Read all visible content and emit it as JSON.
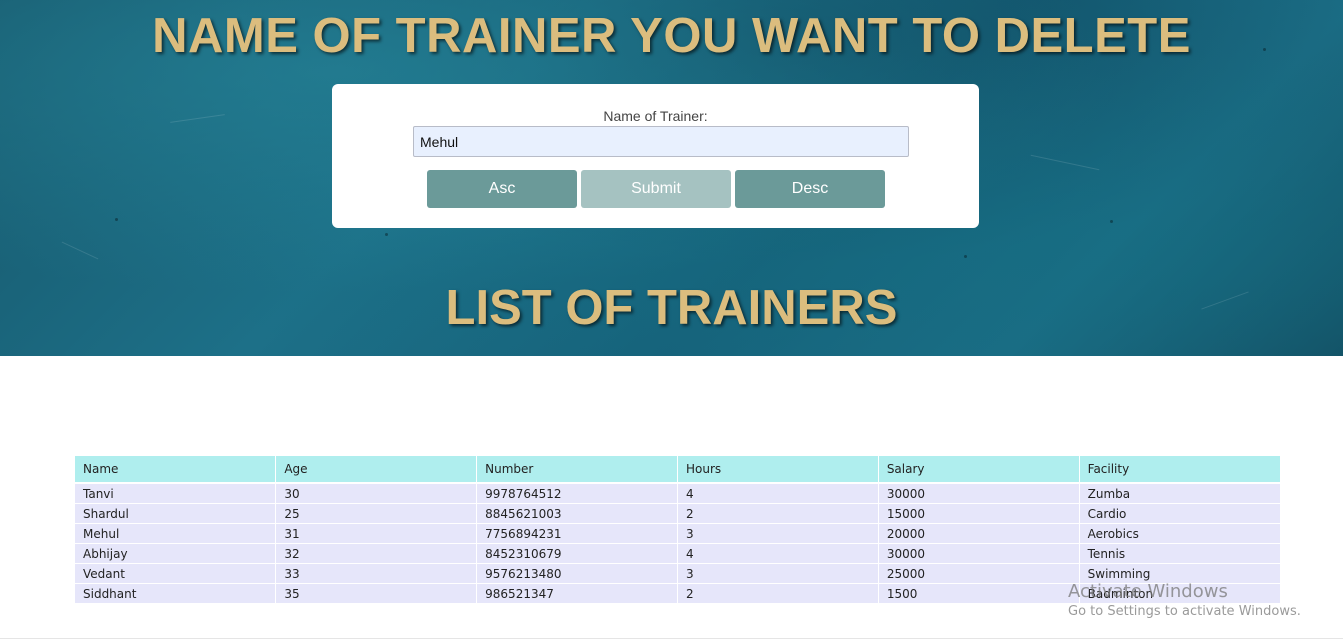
{
  "header": {
    "title": "NAME OF TRAINER YOU WANT TO DELETE",
    "list_title": "LIST OF TRAINERS"
  },
  "form": {
    "label": "Name of Trainer:",
    "input_value": "Mehul",
    "buttons": {
      "asc": "Asc",
      "submit": "Submit",
      "desc": "Desc"
    }
  },
  "table": {
    "columns": [
      "Name",
      "Age",
      "Number",
      "Hours",
      "Salary",
      "Facility"
    ],
    "rows": [
      [
        "Tanvi",
        "30",
        "9978764512",
        "4",
        "30000",
        "Zumba"
      ],
      [
        "Shardul",
        "25",
        "8845621003",
        "2",
        "15000",
        "Cardio"
      ],
      [
        "Mehul",
        "31",
        "7756894231",
        "3",
        "20000",
        "Aerobics"
      ],
      [
        "Abhijay",
        "32",
        "8452310679",
        "4",
        "30000",
        "Tennis"
      ],
      [
        "Vedant",
        "33",
        "9576213480",
        "3",
        "25000",
        "Swimming"
      ],
      [
        "Siddhant",
        "35",
        "986521347",
        "2",
        "1500",
        "Badminton"
      ]
    ]
  },
  "watermark": {
    "line1": "Activate Windows",
    "line2": "Go to Settings to activate Windows."
  },
  "colors": {
    "heading": "#dbbd7e",
    "button": "#6b9a99",
    "button_disabled": "#a5c2c1",
    "table_header": "#afeeee",
    "table_row": "#e6e6fa"
  }
}
